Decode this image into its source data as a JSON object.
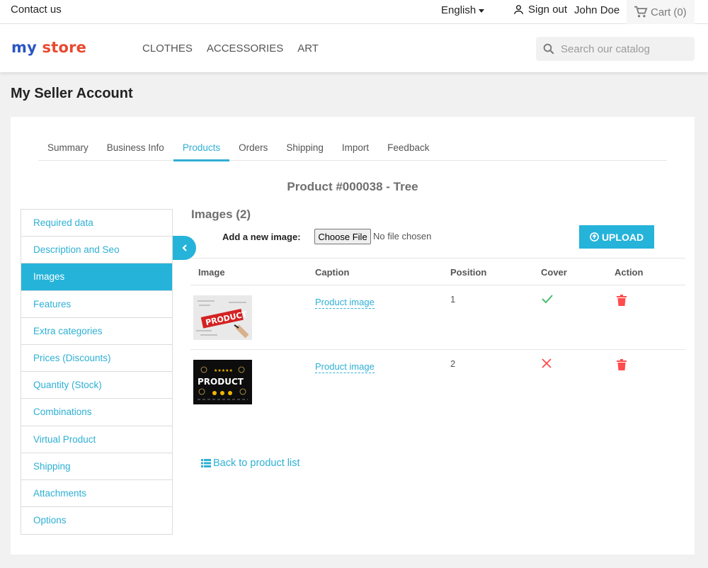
{
  "topbar": {
    "contact": "Contact us",
    "language": "English",
    "signout": "Sign out",
    "username": "John Doe",
    "cart": "Cart",
    "cart_count": "(0)"
  },
  "header": {
    "logo_part1": "my",
    "logo_part2": "store",
    "nav": [
      "CLOTHES",
      "ACCESSORIES",
      "ART"
    ],
    "search_placeholder": "Search our catalog"
  },
  "page": {
    "title": "My Seller Account"
  },
  "tabs": [
    "Summary",
    "Business Info",
    "Products",
    "Orders",
    "Shipping",
    "Import",
    "Feedback"
  ],
  "active_tab": "Products",
  "product_heading": "Product #000038 - Tree",
  "sidemenu": [
    "Required data",
    "Description and Seo",
    "Images",
    "Features",
    "Extra categories",
    "Prices (Discounts)",
    "Quantity (Stock)",
    "Combinations",
    "Virtual Product",
    "Shipping",
    "Attachments",
    "Options"
  ],
  "active_side": "Images",
  "images": {
    "title": "Images (2)",
    "add_label": "Add a new image:",
    "choose_file": "Choose File",
    "no_file": "No file chosen",
    "upload": "UPLOAD"
  },
  "table": {
    "headers": [
      "Image",
      "Caption",
      "Position",
      "Cover",
      "Action"
    ],
    "rows": [
      {
        "thumb_text": "PRODUCT",
        "caption": "Product image",
        "position": "1",
        "cover": "check-icon"
      },
      {
        "thumb_text": "PRODUCT",
        "caption": "Product image",
        "position": "2",
        "cover": "cross-icon"
      }
    ]
  },
  "back_link": "Back to product list",
  "colors": {
    "accent": "#25b3da",
    "success": "#4cbb6c",
    "danger": "#ff4c4c"
  }
}
